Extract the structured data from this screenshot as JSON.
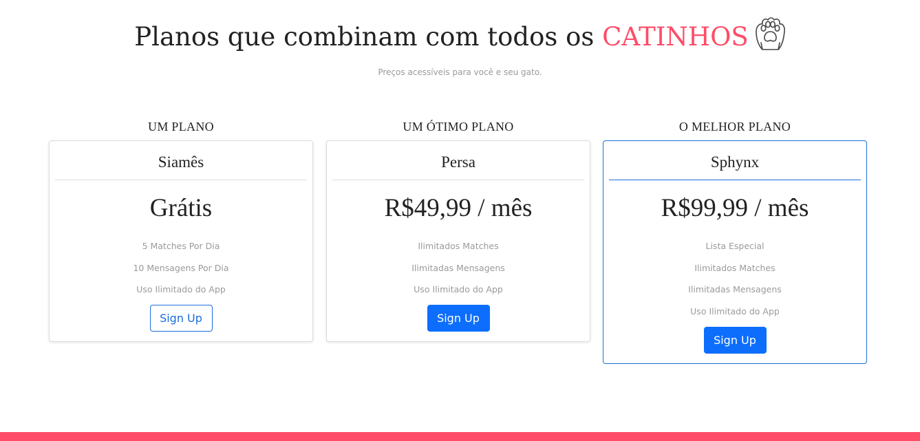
{
  "header": {
    "title_prefix": "Planos que combinam com todos os ",
    "title_accent": "CATINHOS",
    "subtitle": "Preços acessíveis para você e seu gato.",
    "icon": "paw-icon",
    "accent_color": "#ff4c68"
  },
  "plans": [
    {
      "heading": "UM PLANO",
      "name": "Siamês",
      "price": "Grátis",
      "features": [
        "5 Matches Por Dia",
        "10 Mensagens Por Dia",
        "Uso Ilimitado do App"
      ],
      "button_label": "Sign Up",
      "button_style": "outline"
    },
    {
      "heading": "UM ÓTIMO PLANO",
      "name": "Persa",
      "price": "R$49,99 / mês",
      "features": [
        "Ilimitados Matches",
        "Ilimitadas Mensagens",
        "Uso Ilimitado do App"
      ],
      "button_label": "Sign Up",
      "button_style": "solid"
    },
    {
      "heading": "O MELHOR PLANO",
      "name": "Sphynx",
      "price": "R$99,99 / mês",
      "features": [
        "Lista Especial",
        "Ilimitados Matches",
        "Ilimitadas Mensagens",
        "Uso Ilimitado do App"
      ],
      "button_label": "Sign Up",
      "button_style": "solid",
      "featured": true
    }
  ],
  "colors": {
    "primary": "#0d6efd",
    "featured_border": "#1a6ddb",
    "footer": "#ff4c68"
  }
}
